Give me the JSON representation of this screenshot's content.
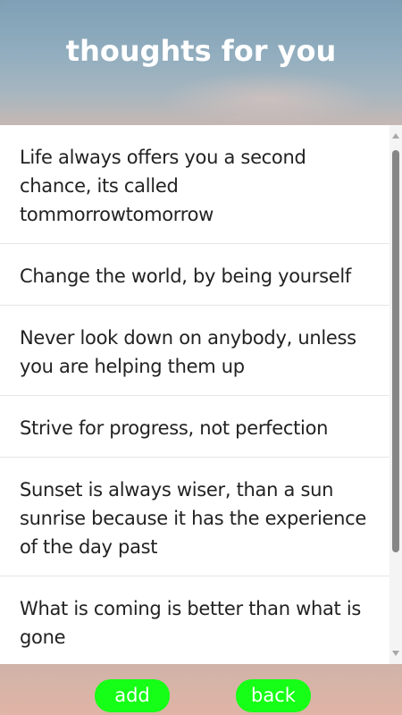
{
  "header": {
    "title": "thoughts for you"
  },
  "thoughts": [
    {
      "text": "Life always offers you a second chance, its called tommorrowtomorrow"
    },
    {
      "text": "Change the world, by being yourself"
    },
    {
      "text": "Never look down on anybody, unless you are helping them up"
    },
    {
      "text": "Strive for progress, not perfection"
    },
    {
      "text": "Sunset is always wiser, than a sun sunrise because it has the experience of the day past"
    },
    {
      "text": "What is coming is better than what is gone"
    }
  ],
  "footer": {
    "add_label": "add",
    "back_label": "back"
  },
  "colors": {
    "button_bg": "#16ff16",
    "button_text": "#ffffff",
    "title_text": "#ffffff"
  },
  "icons": {
    "scroll_up": "scroll-up-arrow-icon",
    "scroll_down": "scroll-down-arrow-icon"
  }
}
